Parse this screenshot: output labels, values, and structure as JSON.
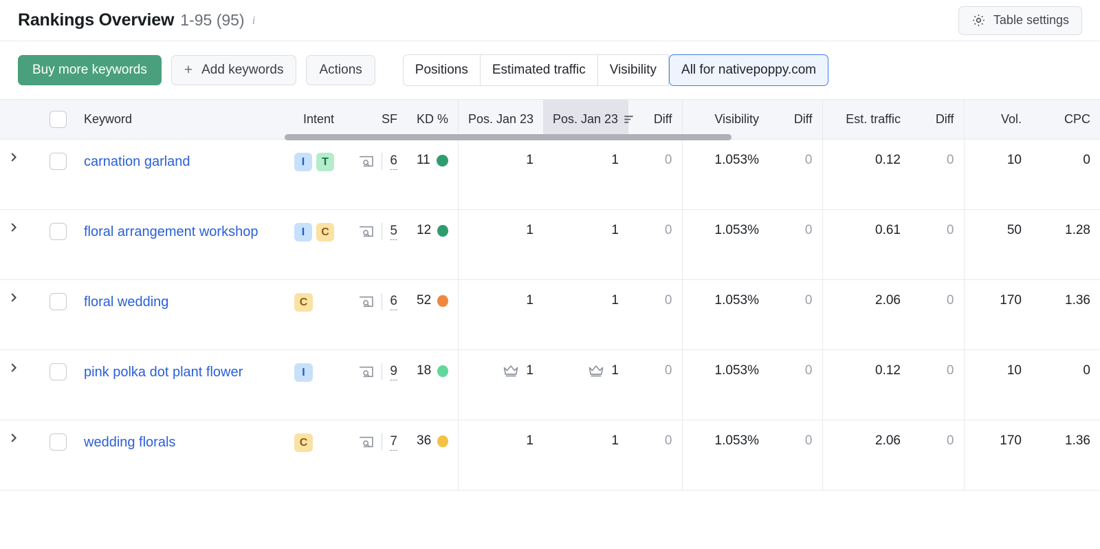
{
  "header": {
    "title": "Rankings Overview",
    "range": "1-95 (95)",
    "info_icon": "info-icon",
    "table_settings_label": "Table settings",
    "gear_icon": "gear-icon"
  },
  "toolbar": {
    "buy_more_keywords": "Buy more keywords",
    "add_keywords": "Add keywords",
    "add_keywords_plus": "+",
    "actions": "Actions",
    "segments": [
      {
        "label": "Positions",
        "active": false
      },
      {
        "label": "Estimated traffic",
        "active": false
      },
      {
        "label": "Visibility",
        "active": false
      },
      {
        "label": "All for nativepoppy.com",
        "active": true
      }
    ]
  },
  "table": {
    "columns": [
      {
        "key": "expand",
        "label": ""
      },
      {
        "key": "select",
        "label": ""
      },
      {
        "key": "keyword",
        "label": "Keyword",
        "align": "left"
      },
      {
        "key": "intent",
        "label": "Intent",
        "align": "right"
      },
      {
        "key": "sf",
        "label": "SF",
        "align": "right"
      },
      {
        "key": "kd",
        "label": "KD %",
        "align": "right"
      },
      {
        "key": "pos1",
        "label": "Pos. Jan 23",
        "align": "right"
      },
      {
        "key": "pos2",
        "label": "Pos. Jan 23",
        "align": "right",
        "sorted": true,
        "sort_icon": "sort-descending-icon"
      },
      {
        "key": "diff1",
        "label": "Diff",
        "align": "right"
      },
      {
        "key": "visibility",
        "label": "Visibility",
        "align": "right"
      },
      {
        "key": "diff2",
        "label": "Diff",
        "align": "right"
      },
      {
        "key": "est_traffic",
        "label": "Est. traffic",
        "align": "right"
      },
      {
        "key": "diff3",
        "label": "Diff",
        "align": "right"
      },
      {
        "key": "vol",
        "label": "Vol.",
        "align": "right"
      },
      {
        "key": "cpc",
        "label": "CPC",
        "align": "right"
      }
    ],
    "rows": [
      {
        "keyword": "carnation garland",
        "intent": [
          "I",
          "T"
        ],
        "sf": "6",
        "kd": "11",
        "kd_color": "#2f9c6e",
        "pos1": "1",
        "pos1_crown": false,
        "pos2": "1",
        "pos2_crown": false,
        "diff1": "0",
        "visibility": "1.053%",
        "diff2": "0",
        "est_traffic": "0.12",
        "diff3": "0",
        "vol": "10",
        "cpc": "0"
      },
      {
        "keyword": "floral arrangement workshop",
        "intent": [
          "I",
          "C"
        ],
        "sf": "5",
        "kd": "12",
        "kd_color": "#2f9c6e",
        "pos1": "1",
        "pos1_crown": false,
        "pos2": "1",
        "pos2_crown": false,
        "diff1": "0",
        "visibility": "1.053%",
        "diff2": "0",
        "est_traffic": "0.61",
        "diff3": "0",
        "vol": "50",
        "cpc": "1.28"
      },
      {
        "keyword": "floral wedding",
        "intent": [
          "C"
        ],
        "sf": "6",
        "kd": "52",
        "kd_color": "#f0873f",
        "pos1": "1",
        "pos1_crown": false,
        "pos2": "1",
        "pos2_crown": false,
        "diff1": "0",
        "visibility": "1.053%",
        "diff2": "0",
        "est_traffic": "2.06",
        "diff3": "0",
        "vol": "170",
        "cpc": "1.36"
      },
      {
        "keyword": "pink polka dot plant flower",
        "intent": [
          "I"
        ],
        "sf": "9",
        "kd": "18",
        "kd_color": "#62d79b",
        "pos1": "1",
        "pos1_crown": true,
        "pos2": "1",
        "pos2_crown": true,
        "diff1": "0",
        "visibility": "1.053%",
        "diff2": "0",
        "est_traffic": "0.12",
        "diff3": "0",
        "vol": "10",
        "cpc": "0"
      },
      {
        "keyword": "wedding florals",
        "intent": [
          "C"
        ],
        "sf": "7",
        "kd": "36",
        "kd_color": "#f3c242",
        "pos1": "1",
        "pos1_crown": false,
        "pos2": "1",
        "pos2_crown": false,
        "diff1": "0",
        "visibility": "1.053%",
        "diff2": "0",
        "est_traffic": "2.06",
        "diff3": "0",
        "vol": "170",
        "cpc": "1.36"
      }
    ]
  },
  "colors": {
    "primary_green": "#4aa07c",
    "link_blue": "#2a5fd8",
    "active_segment_border": "#3b7ff0",
    "active_segment_bg": "#eef4fe",
    "header_bg": "#f5f6f9",
    "sorted_header_bg": "#e2e4ea"
  }
}
